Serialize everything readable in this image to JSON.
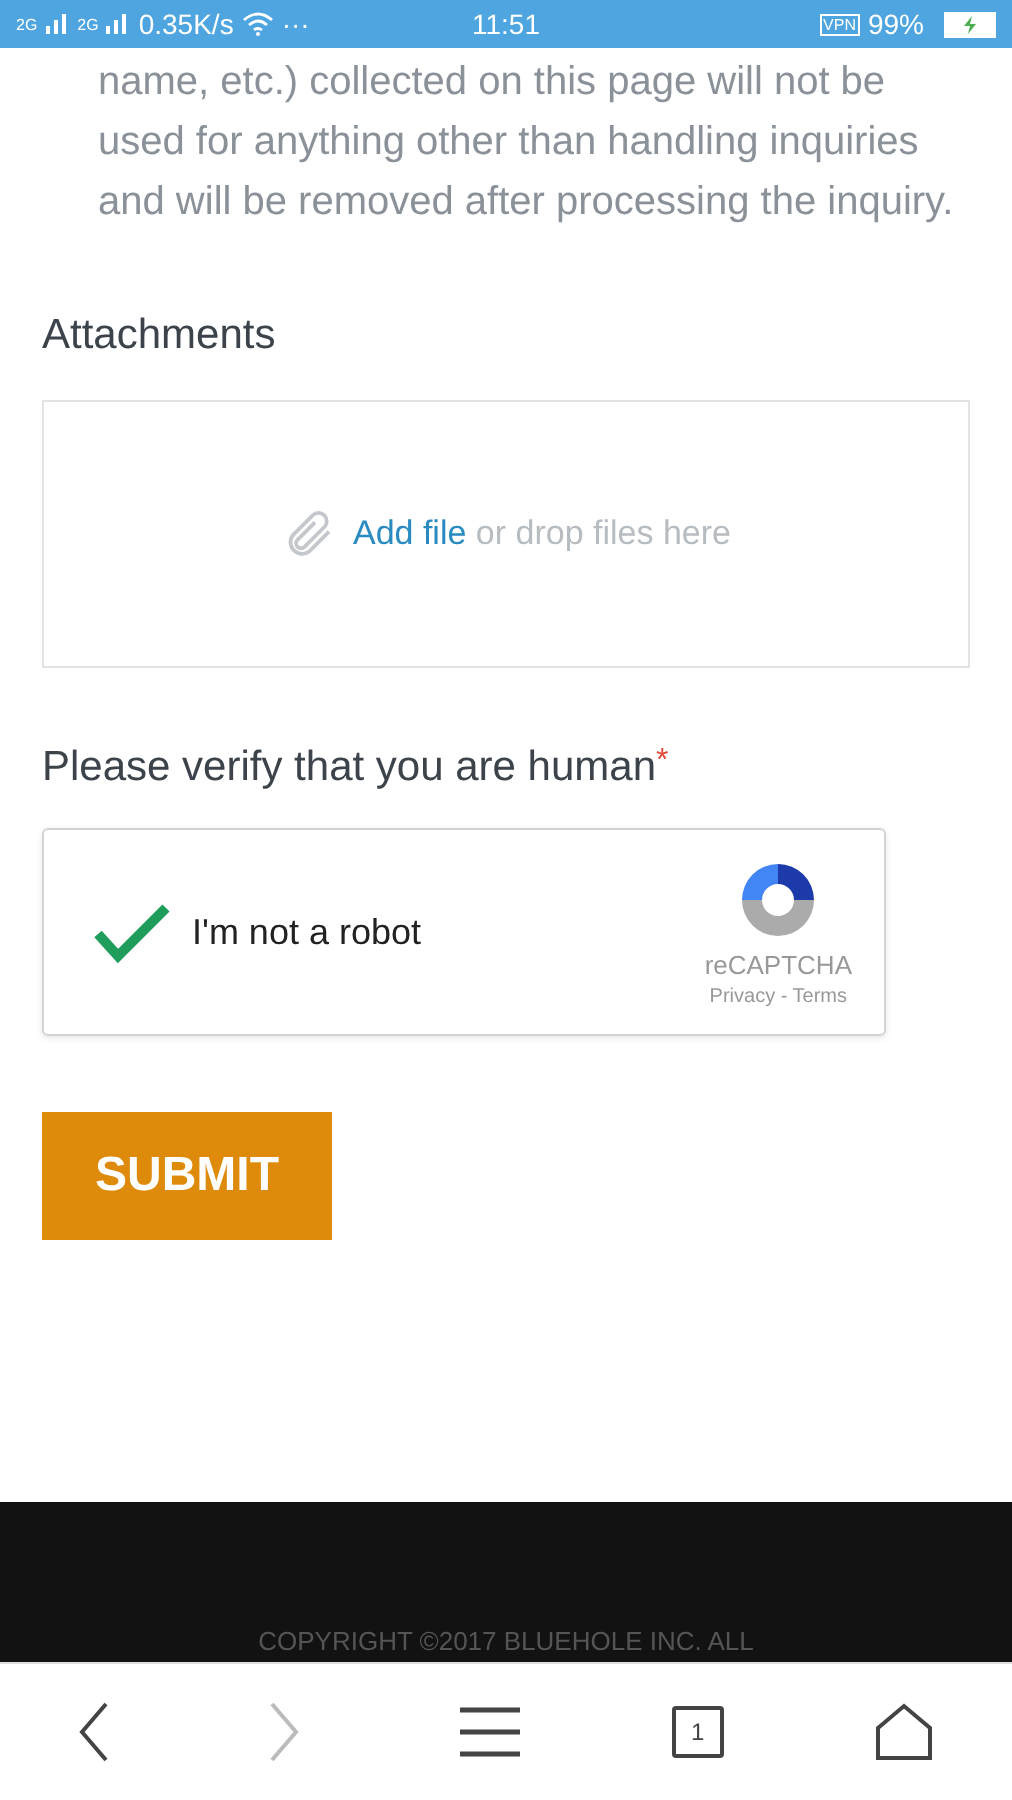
{
  "status_bar": {
    "carrier_1": "2G",
    "carrier_2": "2G",
    "speed": "0.35K/s",
    "more": "···",
    "time": "11:51",
    "vpn": "VPN",
    "battery": "99%",
    "charging": true
  },
  "notice": "name, etc.) collected on this page will not be used for anything other than handling inquiries and will be removed after processing the inquiry.",
  "attachments": {
    "heading": "Attachments",
    "add_link": "Add file",
    "hint": "or drop files here"
  },
  "verify": {
    "heading": "Please verify that you are human",
    "required_mark": "*"
  },
  "captcha": {
    "checked": true,
    "label": "I'm not a robot",
    "brand": "reCAPTCHA",
    "links": "Privacy - Terms"
  },
  "submit": "SUBMIT",
  "footer": {
    "copyright": "COPYRIGHT ©2017 BLUEHOLE INC. ALL"
  },
  "browser_bar": {
    "tab_count": "1",
    "back_disabled": false,
    "forward_disabled": true
  }
}
